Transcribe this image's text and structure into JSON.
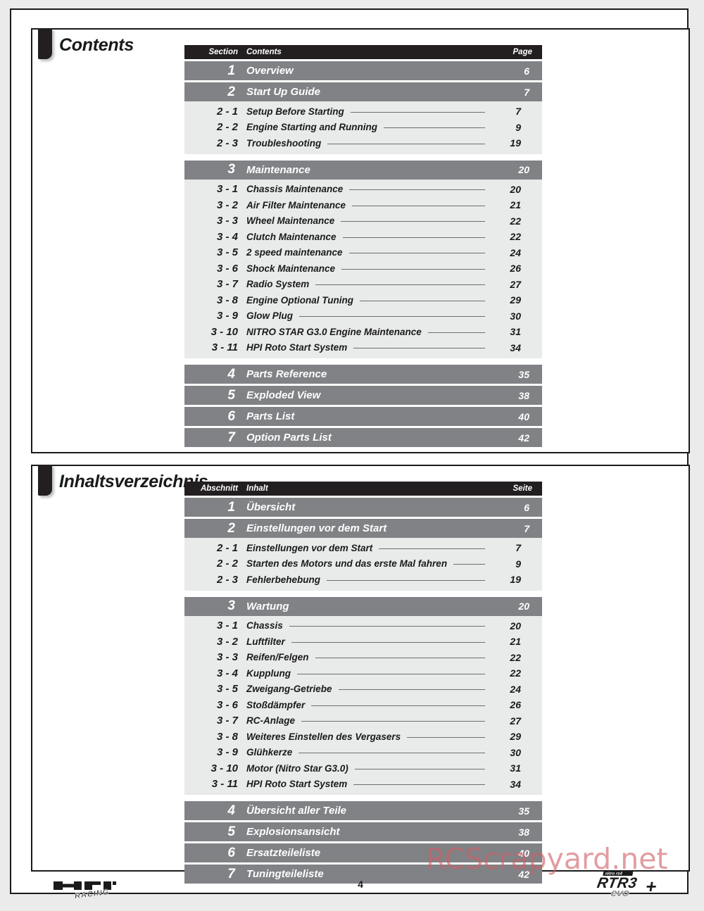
{
  "document": {
    "page_number": "4",
    "watermark": "RCScrapyard.net",
    "brand_logo": "hpi-racing-logo",
    "product_badge_top": "nitro rs4",
    "product_badge_main": "RTR3",
    "product_badge_sub": "evo",
    "product_badge_plus": "+"
  },
  "english": {
    "title": "Contents",
    "headers": {
      "section": "Section",
      "contents": "Contents",
      "page": "Page"
    },
    "rows": [
      {
        "type": "major",
        "section": "1",
        "title": "Overview",
        "page": "6"
      },
      {
        "type": "major",
        "section": "2",
        "title": "Start Up Guide",
        "page": "7"
      },
      {
        "type": "sub",
        "section": "2 - 1",
        "title": "Setup Before Starting",
        "page": "7"
      },
      {
        "type": "sub",
        "section": "2 - 2",
        "title": "Engine Starting and Running",
        "page": "9"
      },
      {
        "type": "sub",
        "section": "2 - 3",
        "title": "Troubleshooting",
        "page": "19"
      },
      {
        "type": "major",
        "section": "3",
        "title": "Maintenance",
        "page": "20"
      },
      {
        "type": "sub",
        "section": "3 - 1",
        "title": "Chassis Maintenance",
        "page": "20"
      },
      {
        "type": "sub",
        "section": "3 - 2",
        "title": "Air Filter Maintenance",
        "page": "21"
      },
      {
        "type": "sub",
        "section": "3 - 3",
        "title": "Wheel Maintenance",
        "page": "22"
      },
      {
        "type": "sub",
        "section": "3 - 4",
        "title": "Clutch Maintenance",
        "page": "22"
      },
      {
        "type": "sub",
        "section": "3 - 5",
        "title": "2 speed maintenance",
        "page": "24"
      },
      {
        "type": "sub",
        "section": "3 - 6",
        "title": "Shock Maintenance",
        "page": "26"
      },
      {
        "type": "sub",
        "section": "3 - 7",
        "title": "Radio System",
        "page": "27"
      },
      {
        "type": "sub",
        "section": "3 - 8",
        "title": "Engine Optional Tuning",
        "page": "29"
      },
      {
        "type": "sub",
        "section": "3 - 9",
        "title": "Glow Plug",
        "page": "30"
      },
      {
        "type": "sub",
        "section": "3 - 10",
        "title": "NITRO STAR G3.0 Engine Maintenance",
        "page": "31"
      },
      {
        "type": "sub",
        "section": "3 - 11",
        "title": "HPI Roto Start System",
        "page": "34"
      },
      {
        "type": "major",
        "section": "4",
        "title": "Parts Reference",
        "page": "35"
      },
      {
        "type": "major",
        "section": "5",
        "title": "Exploded View",
        "page": "38"
      },
      {
        "type": "major",
        "section": "6",
        "title": "Parts List",
        "page": "40"
      },
      {
        "type": "major",
        "section": "7",
        "title": "Option Parts List",
        "page": "42"
      }
    ]
  },
  "german": {
    "title": "Inhaltsverzeichnis",
    "headers": {
      "section": "Abschnitt",
      "contents": "Inhalt",
      "page": "Seite"
    },
    "rows": [
      {
        "type": "major",
        "section": "1",
        "title": "Übersicht",
        "page": "6"
      },
      {
        "type": "major",
        "section": "2",
        "title": "Einstellungen vor dem Start",
        "page": "7"
      },
      {
        "type": "sub",
        "section": "2 - 1",
        "title": "Einstellungen vor dem Start",
        "page": "7"
      },
      {
        "type": "sub",
        "section": "2 - 2",
        "title": "Starten des Motors und das erste Mal fahren",
        "page": "9"
      },
      {
        "type": "sub",
        "section": "2 - 3",
        "title": "Fehlerbehebung",
        "page": "19"
      },
      {
        "type": "major",
        "section": "3",
        "title": "Wartung",
        "page": "20"
      },
      {
        "type": "sub",
        "section": "3 - 1",
        "title": "Chassis",
        "page": "20"
      },
      {
        "type": "sub",
        "section": "3 - 2",
        "title": "Luftfilter",
        "page": "21"
      },
      {
        "type": "sub",
        "section": "3 - 3",
        "title": "Reifen/Felgen",
        "page": "22"
      },
      {
        "type": "sub",
        "section": "3 - 4",
        "title": "Kupplung",
        "page": "22"
      },
      {
        "type": "sub",
        "section": "3 - 5",
        "title": "Zweigang-Getriebe",
        "page": "24"
      },
      {
        "type": "sub",
        "section": "3 - 6",
        "title": "Stoßdämpfer",
        "page": "26"
      },
      {
        "type": "sub",
        "section": "3 - 7",
        "title": "RC-Anlage",
        "page": "27"
      },
      {
        "type": "sub",
        "section": "3 - 8",
        "title": "Weiteres Einstellen des Vergasers",
        "page": "29"
      },
      {
        "type": "sub",
        "section": "3 - 9",
        "title": "Glühkerze",
        "page": "30"
      },
      {
        "type": "sub",
        "section": "3 - 10",
        "title": "Motor (Nitro Star G3.0)",
        "page": "31"
      },
      {
        "type": "sub",
        "section": "3 - 11",
        "title": "HPI Roto Start System",
        "page": "34"
      },
      {
        "type": "major",
        "section": "4",
        "title": "Übersicht aller Teile",
        "page": "35"
      },
      {
        "type": "major",
        "section": "5",
        "title": "Explosionsansicht",
        "page": "38"
      },
      {
        "type": "major",
        "section": "6",
        "title": "Ersatzteileliste",
        "page": "40"
      },
      {
        "type": "major",
        "section": "7",
        "title": "Tuningteileliste",
        "page": "42"
      }
    ]
  },
  "colors": {
    "header_bar": "#231f20",
    "major_row": "#808285",
    "sub_block": "#e9eaea",
    "leader_line": "#6d6e71",
    "watermark": "#ce6068"
  }
}
